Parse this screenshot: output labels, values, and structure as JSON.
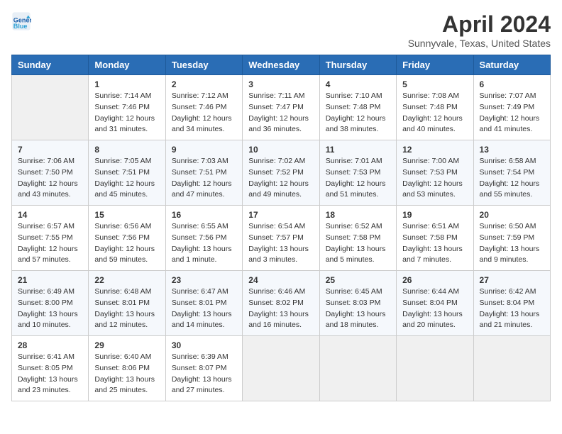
{
  "header": {
    "logo_line1": "General",
    "logo_line2": "Blue",
    "month_year": "April 2024",
    "location": "Sunnyvale, Texas, United States"
  },
  "weekdays": [
    "Sunday",
    "Monday",
    "Tuesday",
    "Wednesday",
    "Thursday",
    "Friday",
    "Saturday"
  ],
  "weeks": [
    [
      {
        "day": "",
        "empty": true
      },
      {
        "day": "1",
        "sunrise": "7:14 AM",
        "sunset": "7:46 PM",
        "daylight": "12 hours and 31 minutes."
      },
      {
        "day": "2",
        "sunrise": "7:12 AM",
        "sunset": "7:46 PM",
        "daylight": "12 hours and 34 minutes."
      },
      {
        "day": "3",
        "sunrise": "7:11 AM",
        "sunset": "7:47 PM",
        "daylight": "12 hours and 36 minutes."
      },
      {
        "day": "4",
        "sunrise": "7:10 AM",
        "sunset": "7:48 PM",
        "daylight": "12 hours and 38 minutes."
      },
      {
        "day": "5",
        "sunrise": "7:08 AM",
        "sunset": "7:48 PM",
        "daylight": "12 hours and 40 minutes."
      },
      {
        "day": "6",
        "sunrise": "7:07 AM",
        "sunset": "7:49 PM",
        "daylight": "12 hours and 41 minutes."
      }
    ],
    [
      {
        "day": "7",
        "sunrise": "7:06 AM",
        "sunset": "7:50 PM",
        "daylight": "12 hours and 43 minutes."
      },
      {
        "day": "8",
        "sunrise": "7:05 AM",
        "sunset": "7:51 PM",
        "daylight": "12 hours and 45 minutes."
      },
      {
        "day": "9",
        "sunrise": "7:03 AM",
        "sunset": "7:51 PM",
        "daylight": "12 hours and 47 minutes."
      },
      {
        "day": "10",
        "sunrise": "7:02 AM",
        "sunset": "7:52 PM",
        "daylight": "12 hours and 49 minutes."
      },
      {
        "day": "11",
        "sunrise": "7:01 AM",
        "sunset": "7:53 PM",
        "daylight": "12 hours and 51 minutes."
      },
      {
        "day": "12",
        "sunrise": "7:00 AM",
        "sunset": "7:53 PM",
        "daylight": "12 hours and 53 minutes."
      },
      {
        "day": "13",
        "sunrise": "6:58 AM",
        "sunset": "7:54 PM",
        "daylight": "12 hours and 55 minutes."
      }
    ],
    [
      {
        "day": "14",
        "sunrise": "6:57 AM",
        "sunset": "7:55 PM",
        "daylight": "12 hours and 57 minutes."
      },
      {
        "day": "15",
        "sunrise": "6:56 AM",
        "sunset": "7:56 PM",
        "daylight": "12 hours and 59 minutes."
      },
      {
        "day": "16",
        "sunrise": "6:55 AM",
        "sunset": "7:56 PM",
        "daylight": "13 hours and 1 minute."
      },
      {
        "day": "17",
        "sunrise": "6:54 AM",
        "sunset": "7:57 PM",
        "daylight": "13 hours and 3 minutes."
      },
      {
        "day": "18",
        "sunrise": "6:52 AM",
        "sunset": "7:58 PM",
        "daylight": "13 hours and 5 minutes."
      },
      {
        "day": "19",
        "sunrise": "6:51 AM",
        "sunset": "7:58 PM",
        "daylight": "13 hours and 7 minutes."
      },
      {
        "day": "20",
        "sunrise": "6:50 AM",
        "sunset": "7:59 PM",
        "daylight": "13 hours and 9 minutes."
      }
    ],
    [
      {
        "day": "21",
        "sunrise": "6:49 AM",
        "sunset": "8:00 PM",
        "daylight": "13 hours and 10 minutes."
      },
      {
        "day": "22",
        "sunrise": "6:48 AM",
        "sunset": "8:01 PM",
        "daylight": "13 hours and 12 minutes."
      },
      {
        "day": "23",
        "sunrise": "6:47 AM",
        "sunset": "8:01 PM",
        "daylight": "13 hours and 14 minutes."
      },
      {
        "day": "24",
        "sunrise": "6:46 AM",
        "sunset": "8:02 PM",
        "daylight": "13 hours and 16 minutes."
      },
      {
        "day": "25",
        "sunrise": "6:45 AM",
        "sunset": "8:03 PM",
        "daylight": "13 hours and 18 minutes."
      },
      {
        "day": "26",
        "sunrise": "6:44 AM",
        "sunset": "8:04 PM",
        "daylight": "13 hours and 20 minutes."
      },
      {
        "day": "27",
        "sunrise": "6:42 AM",
        "sunset": "8:04 PM",
        "daylight": "13 hours and 21 minutes."
      }
    ],
    [
      {
        "day": "28",
        "sunrise": "6:41 AM",
        "sunset": "8:05 PM",
        "daylight": "13 hours and 23 minutes."
      },
      {
        "day": "29",
        "sunrise": "6:40 AM",
        "sunset": "8:06 PM",
        "daylight": "13 hours and 25 minutes."
      },
      {
        "day": "30",
        "sunrise": "6:39 AM",
        "sunset": "8:07 PM",
        "daylight": "13 hours and 27 minutes."
      },
      {
        "day": "",
        "empty": true
      },
      {
        "day": "",
        "empty": true
      },
      {
        "day": "",
        "empty": true
      },
      {
        "day": "",
        "empty": true
      }
    ]
  ]
}
